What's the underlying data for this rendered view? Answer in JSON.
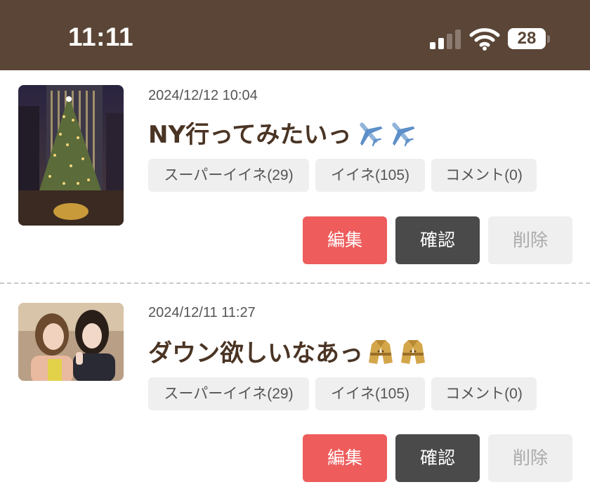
{
  "status_bar": {
    "time": "11:11",
    "battery": "28",
    "icons": [
      "cellular-signal-icon",
      "wifi-icon",
      "battery-icon"
    ]
  },
  "colors": {
    "header_bg": "#5a4536",
    "edit": "#ee5c5c",
    "confirm": "#4a4a4a",
    "delete": "#efefef",
    "title": "#4a3424"
  },
  "posts": [
    {
      "date": "2024/12/12 10:04",
      "title": "NY行ってみたいっ",
      "emojis": [
        "airplane-emoji",
        "airplane-emoji"
      ],
      "thumbnail": "christmas-tree-photo",
      "chips": {
        "super": "スーパーイイネ(29)",
        "like": "イイネ(105)",
        "comment": "コメント(0)"
      },
      "buttons": {
        "edit": "編集",
        "confirm": "確認",
        "delete": "削除"
      }
    },
    {
      "date": "2024/12/11 11:27",
      "title": "ダウン欲しいなあっ",
      "emojis": [
        "coat-emoji",
        "coat-emoji"
      ],
      "thumbnail": "selfie-photo",
      "chips": {
        "super": "スーパーイイネ(29)",
        "like": "イイネ(105)",
        "comment": "コメント(0)"
      },
      "buttons": {
        "edit": "編集",
        "confirm": "確認",
        "delete": "削除"
      }
    }
  ]
}
